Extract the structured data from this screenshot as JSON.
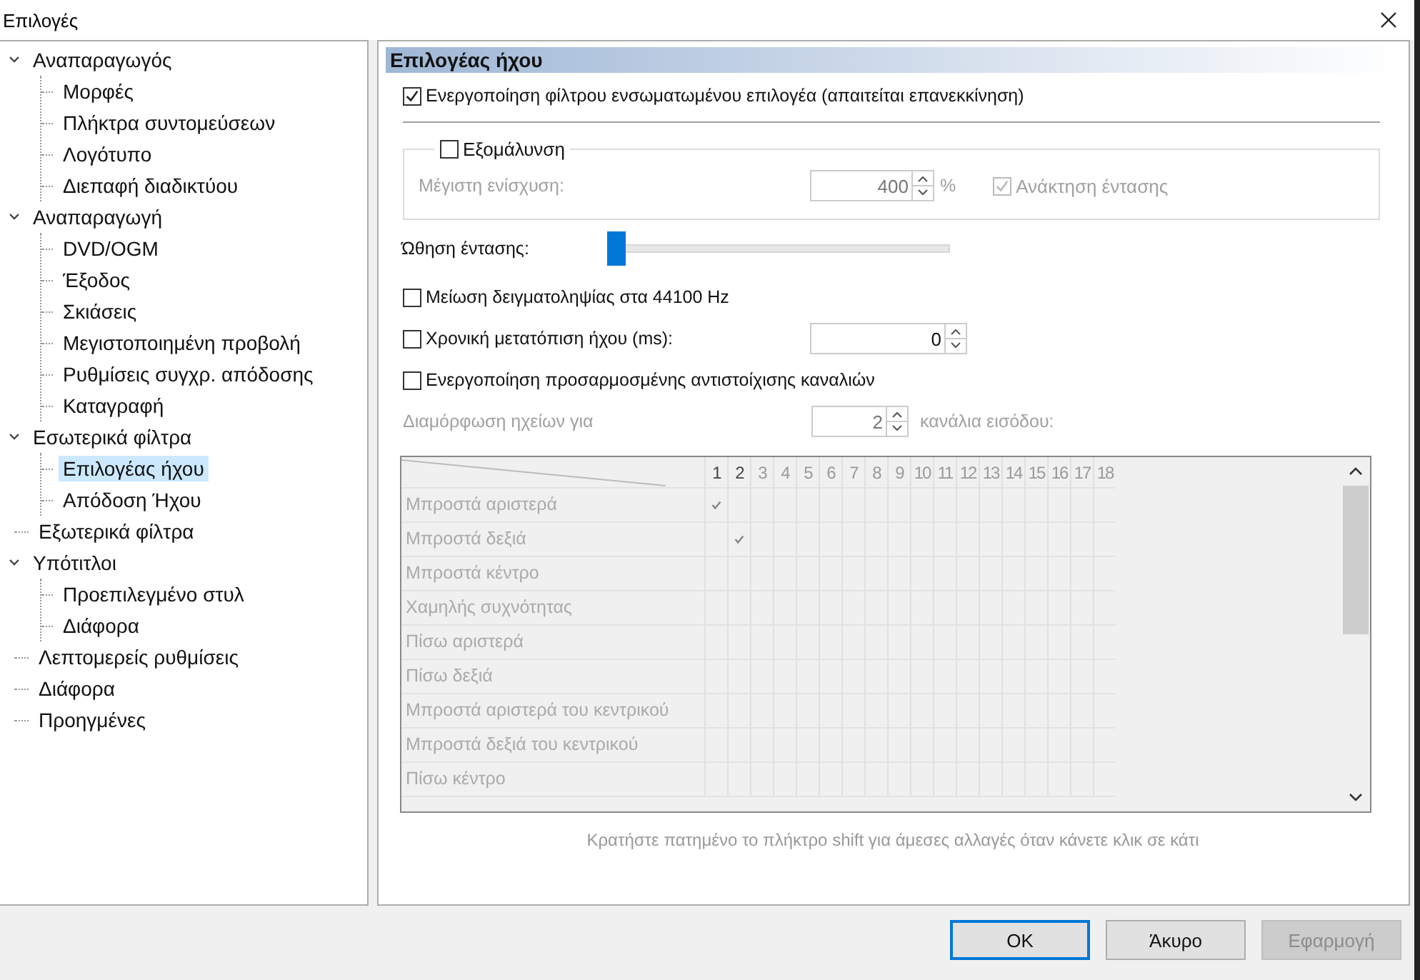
{
  "window": {
    "title": "Επιλογές"
  },
  "tree": [
    {
      "label": "Αναπαραγωγός",
      "selected": false,
      "expanded": true,
      "children": [
        {
          "label": "Μορφές",
          "selected": false
        },
        {
          "label": "Πλήκτρα συντομεύσεων",
          "selected": false
        },
        {
          "label": "Λογότυπο",
          "selected": false
        },
        {
          "label": "Διεπαφή διαδικτύου",
          "selected": false
        }
      ]
    },
    {
      "label": "Αναπαραγωγή",
      "selected": false,
      "expanded": true,
      "children": [
        {
          "label": "DVD/OGM",
          "selected": false
        },
        {
          "label": "Έξοδος",
          "selected": false
        },
        {
          "label": "Σκιάσεις",
          "selected": false
        },
        {
          "label": "Μεγιστοποιημένη προβολή",
          "selected": false
        },
        {
          "label": "Ρυθμίσεις συγχρ. απόδοσης",
          "selected": false
        },
        {
          "label": "Καταγραφή",
          "selected": false
        }
      ]
    },
    {
      "label": "Εσωτερικά φίλτρα",
      "selected": false,
      "expanded": true,
      "children": [
        {
          "label": "Επιλογέας ήχου",
          "selected": true
        },
        {
          "label": "Απόδοση Ήχου",
          "selected": false
        }
      ]
    },
    {
      "label": "Εξωτερικά φίλτρα",
      "selected": false
    },
    {
      "label": "Υπότιτλοι",
      "selected": false,
      "expanded": true,
      "children": [
        {
          "label": "Προεπιλεγμένο στυλ",
          "selected": false
        },
        {
          "label": "Διάφορα",
          "selected": false
        }
      ]
    },
    {
      "label": "Λεπτομερείς ρυθμίσεις",
      "selected": false
    },
    {
      "label": "Διάφορα",
      "selected": false
    },
    {
      "label": "Προηγμένες",
      "selected": false
    }
  ],
  "panel": {
    "title": "Επιλογέας ήχου",
    "enable_filter": {
      "label": "Ενεργοποίηση φίλτρου ενσωματωμένου επιλογέα (απαιτείται επανεκκίνηση)",
      "checked": true
    },
    "normalize": {
      "label": "Εξομάλυνση",
      "checked": false,
      "max_gain_label": "Μέγιστη ενίσχυση:",
      "max_gain_value": "400",
      "unit": "%",
      "restore": {
        "label": "Ανάκτηση έντασης",
        "checked": true
      }
    },
    "boost": {
      "label": "Ώθηση έντασης:",
      "level": 0.0
    },
    "downsample": {
      "label": "Μείωση δειγματοληψίας στα 44100 Hz",
      "checked": false
    },
    "time_shift": {
      "label": "Χρονική μετατόπιση ήχου (ms):",
      "checked": false,
      "value": "0"
    },
    "custom_mapping": {
      "label": "Ενεργοποίηση προσαρμοσμένης αντιστοίχισης καναλιών",
      "checked": false
    },
    "speakers": {
      "label": "Διαμόρφωση ηχείων για",
      "value": "2",
      "suffix": "κανάλια εισόδου:"
    },
    "matrix": {
      "columns": [
        {
          "label": "1",
          "enabled": true
        },
        {
          "label": "2",
          "enabled": true
        },
        {
          "label": "3",
          "enabled": false
        },
        {
          "label": "4",
          "enabled": false
        },
        {
          "label": "5",
          "enabled": false
        },
        {
          "label": "6",
          "enabled": false
        },
        {
          "label": "7",
          "enabled": false
        },
        {
          "label": "8",
          "enabled": false
        },
        {
          "label": "9",
          "enabled": false
        },
        {
          "label": "10",
          "enabled": false
        },
        {
          "label": "11",
          "enabled": false
        },
        {
          "label": "12",
          "enabled": false
        },
        {
          "label": "13",
          "enabled": false
        },
        {
          "label": "14",
          "enabled": false
        },
        {
          "label": "15",
          "enabled": false
        },
        {
          "label": "16",
          "enabled": false
        },
        {
          "label": "17",
          "enabled": false
        },
        {
          "label": "18",
          "enabled": false
        }
      ],
      "rows": [
        {
          "label": "Μπροστά αριστερά",
          "checked": [
            true,
            false,
            false,
            false,
            false,
            false,
            false,
            false,
            false,
            false,
            false,
            false,
            false,
            false,
            false,
            false,
            false,
            false
          ]
        },
        {
          "label": "Μπροστά δεξιά",
          "checked": [
            false,
            true,
            false,
            false,
            false,
            false,
            false,
            false,
            false,
            false,
            false,
            false,
            false,
            false,
            false,
            false,
            false,
            false
          ]
        },
        {
          "label": "Μπροστά κέντρο",
          "checked": [
            false,
            false,
            false,
            false,
            false,
            false,
            false,
            false,
            false,
            false,
            false,
            false,
            false,
            false,
            false,
            false,
            false,
            false
          ]
        },
        {
          "label": "Χαμηλής συχνότητας",
          "checked": [
            false,
            false,
            false,
            false,
            false,
            false,
            false,
            false,
            false,
            false,
            false,
            false,
            false,
            false,
            false,
            false,
            false,
            false
          ]
        },
        {
          "label": "Πίσω αριστερά",
          "checked": [
            false,
            false,
            false,
            false,
            false,
            false,
            false,
            false,
            false,
            false,
            false,
            false,
            false,
            false,
            false,
            false,
            false,
            false
          ]
        },
        {
          "label": "Πίσω δεξιά",
          "checked": [
            false,
            false,
            false,
            false,
            false,
            false,
            false,
            false,
            false,
            false,
            false,
            false,
            false,
            false,
            false,
            false,
            false,
            false
          ]
        },
        {
          "label": "Μπροστά αριστερά του κεντρικού",
          "checked": [
            false,
            false,
            false,
            false,
            false,
            false,
            false,
            false,
            false,
            false,
            false,
            false,
            false,
            false,
            false,
            false,
            false,
            false
          ]
        },
        {
          "label": "Μπροστά δεξιά του κεντρικού",
          "checked": [
            false,
            false,
            false,
            false,
            false,
            false,
            false,
            false,
            false,
            false,
            false,
            false,
            false,
            false,
            false,
            false,
            false,
            false
          ]
        },
        {
          "label": "Πίσω κέντρο",
          "checked": [
            false,
            false,
            false,
            false,
            false,
            false,
            false,
            false,
            false,
            false,
            false,
            false,
            false,
            false,
            false,
            false,
            false,
            false
          ]
        }
      ]
    },
    "hint": "Κρατήστε πατημένο το πλήκτρο shift για άμεσες αλλαγές όταν κάνετε κλικ σε κάτι"
  },
  "buttons": [
    {
      "label": "OK",
      "kind": "default",
      "disabled": false
    },
    {
      "label": "Άκυρο",
      "kind": "normal",
      "disabled": false
    },
    {
      "label": "Εφαρμογή",
      "kind": "normal",
      "disabled": true
    }
  ]
}
